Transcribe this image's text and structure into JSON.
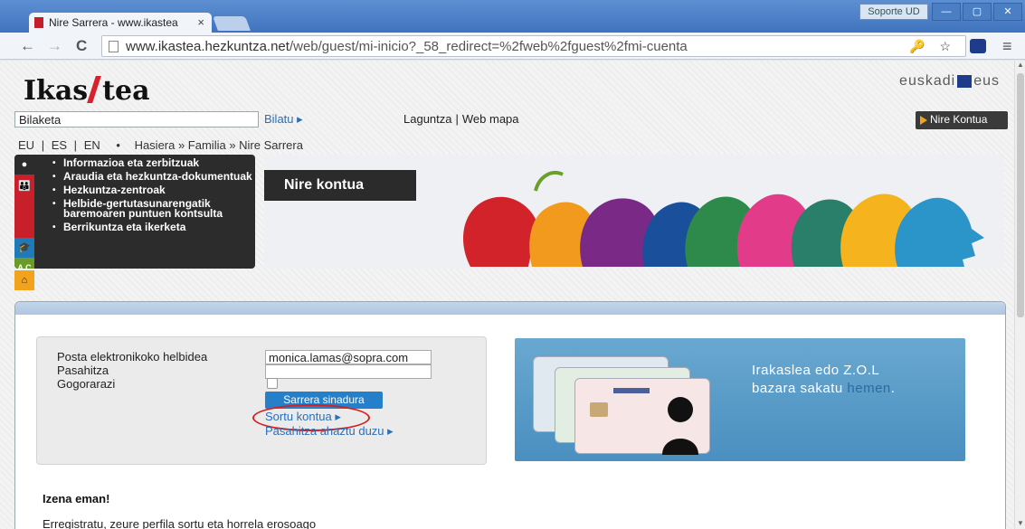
{
  "browser": {
    "tab_title": "Nire Sarrera - www.ikastea",
    "tab_close": "×",
    "user_button": "Soporte UD",
    "window_buttons": [
      "—",
      "▢",
      "✕"
    ],
    "url_host": "www.ikastea.hezkuntza.net",
    "url_path": "/web/guest/mi-inicio?_58_redirect=%2fweb%2fguest%2fmi-cuenta",
    "back": "←",
    "forward": "→",
    "reload": "C",
    "omni_icons": "🔑 ☆",
    "menu": "≡"
  },
  "site": {
    "logo_left": "Ikas",
    "logo_right": "tea",
    "brand_right_1": "euskadi",
    "brand_right_2": "eus"
  },
  "topbar": {
    "search_value": "Bilaketa",
    "search_button": "Bilatu ▸",
    "help": "Laguntza",
    "sitemap": "Web mapa",
    "account_button": "Nire Kontua"
  },
  "breadcrumbs": {
    "langs": [
      "EU",
      "|",
      "ES",
      "|",
      "EN"
    ],
    "path": "Hasiera » Familia » Nire Sarrera"
  },
  "sidemenu": {
    "items": [
      "Informazioa eta zerbitzuak",
      "Araudia eta hezkuntza-dokumentuak",
      "Hezkuntza-zentroak",
      "Helbide-gertutasunarengatik baremoaren puntuen kontsulta",
      "Berrikuntza eta ikerketa"
    ]
  },
  "banner": {
    "label": "Nire kontua"
  },
  "login": {
    "email_label": "Posta elektronikoko helbidea",
    "email_value": "monica.lamas@sopra.com",
    "password_label": "Pasahitza",
    "remember_label": "Gogorarazi",
    "submit_label": "Sarrera sinadura",
    "create_account": "Sortu kontua ▸",
    "forgot_password": "Pasahitza ahaztu duzu ▸"
  },
  "teacher_panel": {
    "line1": "Irakaslea edo Z.O.L",
    "line2": "bazara sakatu",
    "link": "hemen",
    "end": "."
  },
  "register": {
    "title": "Izena eman!",
    "text": "Erregistratu, zeure perfila sortu eta horrela erosoago"
  },
  "colors": {
    "accent_red": "#d5232e",
    "link_blue": "#2b6fb6",
    "submit_blue": "#2680c9",
    "orange": "#f3a31b"
  }
}
